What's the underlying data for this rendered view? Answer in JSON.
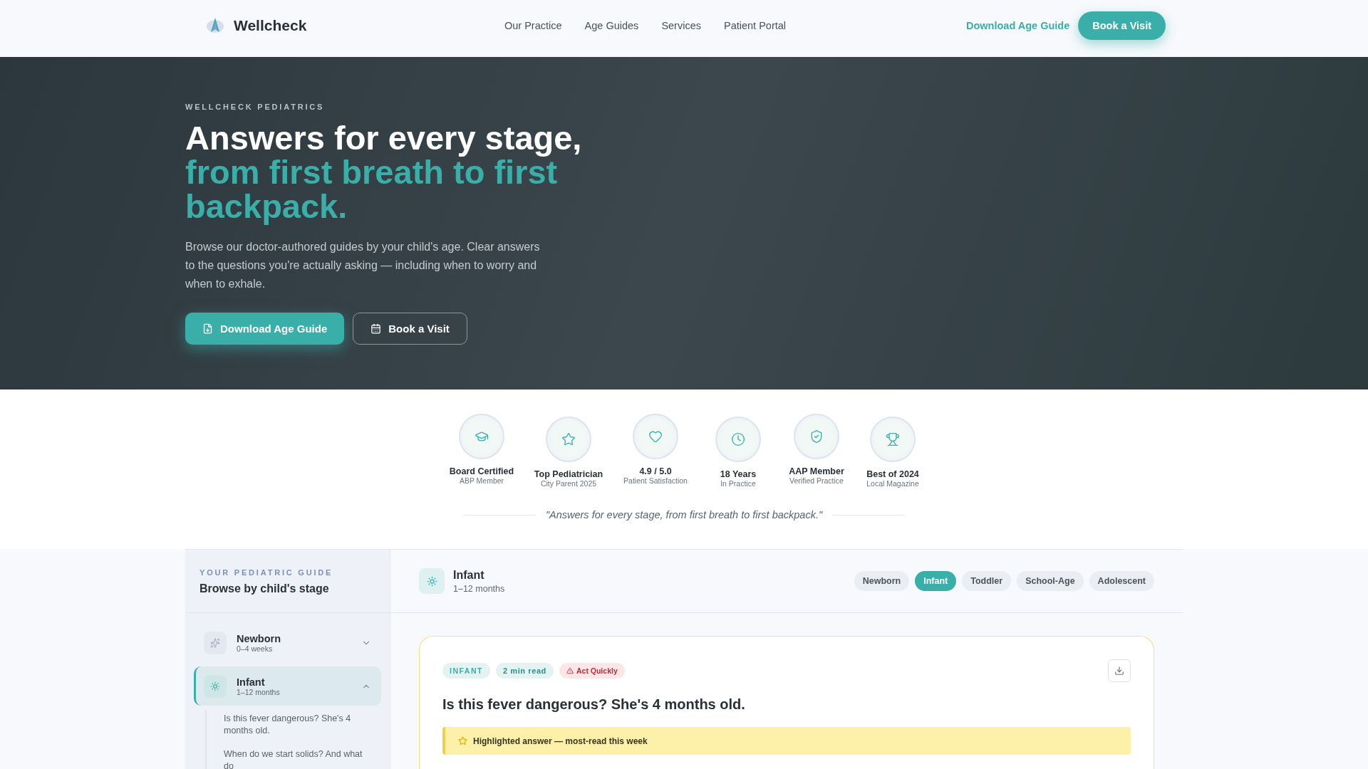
{
  "nav": {
    "brand": "Wellcheck",
    "links": [
      "Our Practice",
      "Age Guides",
      "Services",
      "Patient Portal"
    ],
    "download_link": "Download Age Guide",
    "cta": "Book a Visit"
  },
  "hero": {
    "eyebrow": "WELLCHECK PEDIATRICS",
    "title": "Answers for every stage,",
    "title_accent": "from first breath to first backpack.",
    "text": "Browse our doctor-authored guides by your child's age. Clear answers to the questions you're actually asking — including when to worry and when to exhale.",
    "buttons": [
      {
        "label": "Download Age Guide",
        "kind": "primary"
      },
      {
        "label": "Book a Visit",
        "kind": "outline"
      }
    ]
  },
  "badges": [
    {
      "title": "Board Certified",
      "subtitle": "ABP Member"
    },
    {
      "title": "Top Pediatrician",
      "subtitle": "City Parent 2025"
    },
    {
      "title": "4.9 / 5.0",
      "subtitle": "Patient Satisfaction"
    },
    {
      "title": "18 Years",
      "subtitle": "In Practice"
    },
    {
      "title": "AAP Member",
      "subtitle": "Verified Practice"
    },
    {
      "title": "Best of 2024",
      "subtitle": "Local Magazine"
    }
  ],
  "tagline": "\"Answers for every stage, from first breath to first backpack.\"",
  "guide": {
    "eyebrow": "YOUR PEDIATRIC GUIDE",
    "title": "Browse by child's stage",
    "stages": [
      {
        "name": "Newborn",
        "range": "0–4 weeks",
        "selected": false,
        "expanded": false
      },
      {
        "name": "Infant",
        "range": "1–12 months",
        "selected": true,
        "expanded": true,
        "questions": [
          "Is this fever dangerous? She's 4 months old.",
          "When do we start solids? And what do"
        ]
      }
    ]
  },
  "content": {
    "stage": {
      "name": "Infant",
      "range": "1–12 months"
    },
    "filters": [
      {
        "label": "Newborn",
        "selected": false
      },
      {
        "label": "Infant",
        "selected": true
      },
      {
        "label": "Toddler",
        "selected": false
      },
      {
        "label": "School-Age",
        "selected": false
      },
      {
        "label": "Adolescent",
        "selected": false
      }
    ],
    "card": {
      "tags": [
        {
          "label": "INFANT",
          "kind": "stage"
        },
        {
          "label": "2 min read",
          "kind": "time"
        },
        {
          "label": "Act Quickly",
          "kind": "alert"
        }
      ],
      "question": "Is this fever dangerous? She's 4 months old.",
      "highlight": "Highlighted answer — most-read this week"
    }
  }
}
